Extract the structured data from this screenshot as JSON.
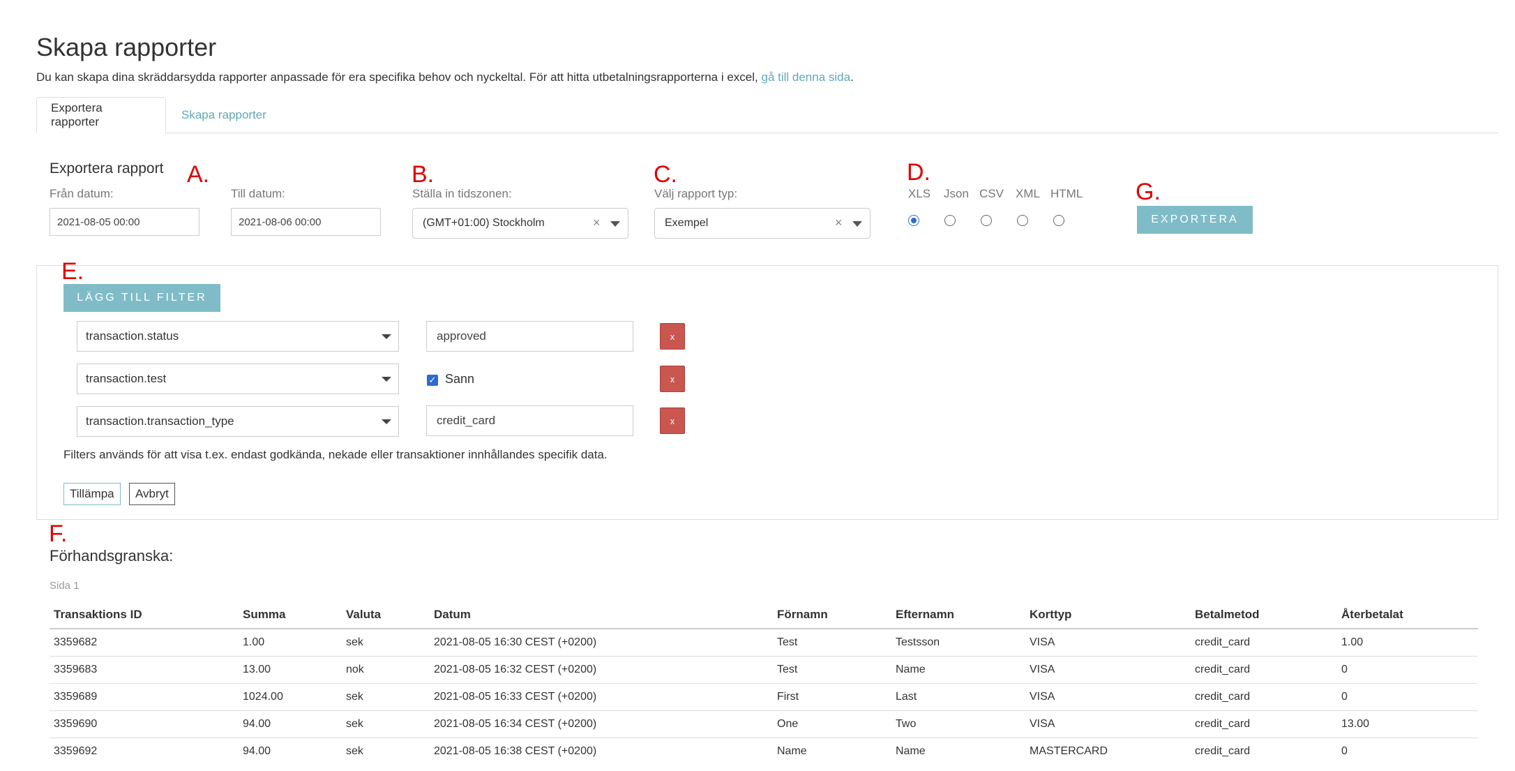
{
  "page": {
    "title": "Skapa rapporter",
    "intro_text": "Du kan skapa dina skräddarsydda rapporter anpassade för era specifika behov och nyckeltal. För att hitta utbetalningsrapporterna i excel, ",
    "intro_link": "gå till denna sida",
    "intro_end": "."
  },
  "tabs": [
    {
      "label": "Exportera rapporter",
      "active": true
    },
    {
      "label": "Skapa rapporter",
      "active": false
    }
  ],
  "markers": {
    "a": "A.",
    "b": "B.",
    "c": "C.",
    "d": "D.",
    "e": "E.",
    "f": "F.",
    "g": "G."
  },
  "export": {
    "section_title": "Exportera rapport",
    "from_label": "Från datum:",
    "from_value": "2021-08-05   00:00",
    "to_label": "Till datum:",
    "to_value": "2021-08-06   00:00",
    "timezone_label": "Ställa in tidszonen:",
    "timezone_value": "(GMT+01:00) Stockholm",
    "report_type_label": "Välj rapport typ:",
    "report_type_value": "Exempel",
    "formats": [
      {
        "label": "XLS",
        "checked": true
      },
      {
        "label": "Json",
        "checked": false
      },
      {
        "label": "CSV",
        "checked": false
      },
      {
        "label": "XML",
        "checked": false
      },
      {
        "label": "HTML",
        "checked": false
      }
    ],
    "export_button": "EXPORTERA",
    "clear_glyph": "×"
  },
  "filters": {
    "add_button": "LÄGG TILL FILTER",
    "rows": [
      {
        "field": "transaction.status",
        "value": "approved",
        "type": "text"
      },
      {
        "field": "transaction.test",
        "value": "Sann",
        "type": "checkbox",
        "checked": true
      },
      {
        "field": "transaction.transaction_type",
        "value": "credit_card",
        "type": "text"
      }
    ],
    "remove_label": "x",
    "help_text": "Filters används för att visa t.ex. endast godkända, nekade eller transaktioner innhållandes specifik data.",
    "apply_button": "Tillämpa",
    "cancel_button": "Avbryt"
  },
  "preview": {
    "title": "Förhandsgranska:",
    "page_label": "Sida 1",
    "columns": [
      "Transaktions ID",
      "Summa",
      "Valuta",
      "Datum",
      "Förnamn",
      "Efternamn",
      "Korttyp",
      "Betalmetod",
      "Återbetalat"
    ],
    "rows": [
      [
        "3359682",
        "1.00",
        "sek",
        "2021-08-05 16:30 CEST (+0200)",
        "Test",
        "Testsson",
        "VISA",
        "credit_card",
        "1.00"
      ],
      [
        "3359683",
        "13.00",
        "nok",
        "2021-08-05 16:32 CEST (+0200)",
        "Test",
        "Name",
        "VISA",
        "credit_card",
        "0"
      ],
      [
        "3359689",
        "1024.00",
        "sek",
        "2021-08-05 16:33 CEST (+0200)",
        "First",
        "Last",
        "VISA",
        "credit_card",
        "0"
      ],
      [
        "3359690",
        "94.00",
        "sek",
        "2021-08-05 16:34 CEST (+0200)",
        "One",
        "Two",
        "VISA",
        "credit_card",
        "13.00"
      ],
      [
        "3359692",
        "94.00",
        "sek",
        "2021-08-05 16:38 CEST (+0200)",
        "Name",
        "Name",
        "MASTERCARD",
        "credit_card",
        "0"
      ]
    ]
  },
  "colors": {
    "accent": "#7fbcc7",
    "link": "#5fa8b8",
    "danger": "#c9574f",
    "marker": "#e00000",
    "radio": "#2c6bd1"
  }
}
